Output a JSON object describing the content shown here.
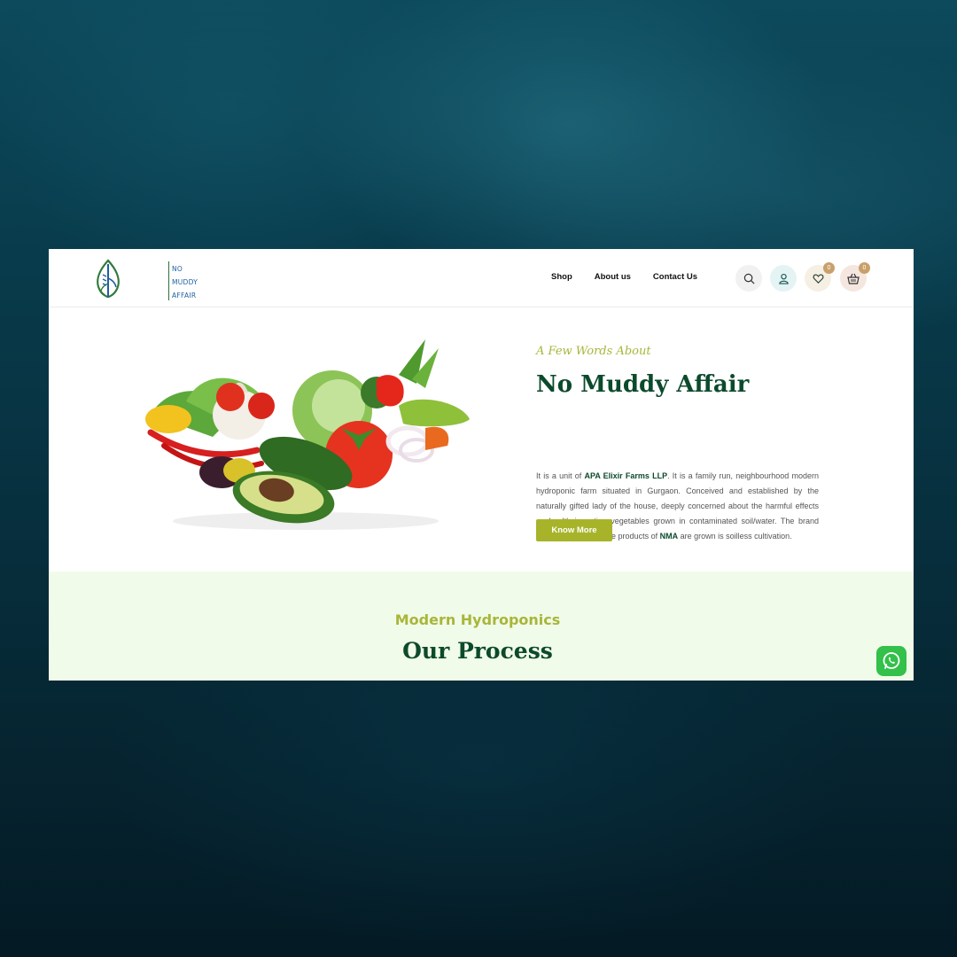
{
  "brand": {
    "logo_lines": [
      "NO",
      "MUDDY",
      "AFFAIR"
    ]
  },
  "nav": {
    "items": [
      {
        "label": "Shop"
      },
      {
        "label": "About us"
      },
      {
        "label": "Contact Us"
      }
    ]
  },
  "header_icons": {
    "search": "search-icon",
    "account": "user-icon",
    "wishlist": {
      "icon": "heart-icon",
      "count": "0"
    },
    "cart": {
      "icon": "basket-icon",
      "count": "0"
    }
  },
  "about": {
    "script_heading": "A Few Words About",
    "title": "No Muddy Affair",
    "description": {
      "part1": "It is a unit of ",
      "company": "APA Elixir Farms LLP",
      "part2": ". It is a family run, neighbourhood modern hydroponic farm situated in Gurgaon. Conceived and established by the naturally gifted lady of the house, deeply concerned about the harmful effects on health in eating vegetables grown in contaminated soil/water. The brand name signifies that the products of ",
      "brand_short": "NMA",
      "part3": " are grown is soilless cultivation."
    },
    "button_label": "Know More"
  },
  "process": {
    "subtitle": "Modern Hydroponics",
    "title": "Our Process"
  },
  "colors": {
    "brand_green": "#0c4a2c",
    "accent_olive": "#a7b42a",
    "process_bg": "#f1fbe9",
    "whatsapp": "#33c04b"
  }
}
